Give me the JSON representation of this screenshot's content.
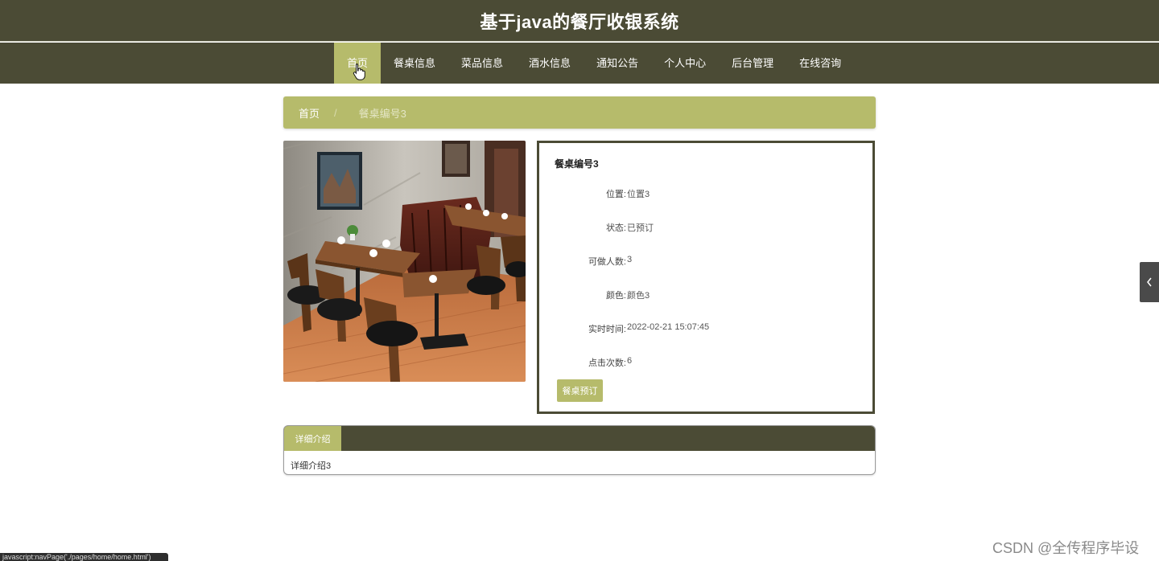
{
  "site": {
    "title": "基于java的餐厅收银系统"
  },
  "nav": {
    "items": [
      {
        "label": "首页",
        "active": true
      },
      {
        "label": "餐桌信息"
      },
      {
        "label": "菜品信息"
      },
      {
        "label": "酒水信息"
      },
      {
        "label": "通知公告"
      },
      {
        "label": "个人中心"
      },
      {
        "label": "后台管理"
      },
      {
        "label": "在线咨询"
      }
    ]
  },
  "breadcrumb": {
    "home": "首页",
    "separator": "/",
    "current": "餐桌编号3"
  },
  "product": {
    "title": "餐桌编号3",
    "fields": [
      {
        "label": "位置:",
        "value": "位置3"
      },
      {
        "label": "状态:",
        "value": "已预订"
      },
      {
        "label": "可做人数:",
        "value": "3"
      },
      {
        "label": "颜色:",
        "value": "颜色3"
      },
      {
        "label": "实时时间:",
        "value": "2022-02-21 15:07:45"
      },
      {
        "label": "点击次数:",
        "value": "6"
      }
    ],
    "book_button": "餐桌预订"
  },
  "detail": {
    "tab_label": "详细介绍",
    "content": "详细介绍3"
  },
  "status_bar": {
    "text": "javascript:navPage('./pages/home/home.html')"
  },
  "watermark": {
    "text": "CSDN @全传程序毕设"
  },
  "colors": {
    "header_bg": "#4b4b35",
    "accent": "#b6bb6b"
  },
  "icons": {
    "side_toggle": "chevron-left-icon",
    "cursor": "hand-pointer-icon"
  }
}
